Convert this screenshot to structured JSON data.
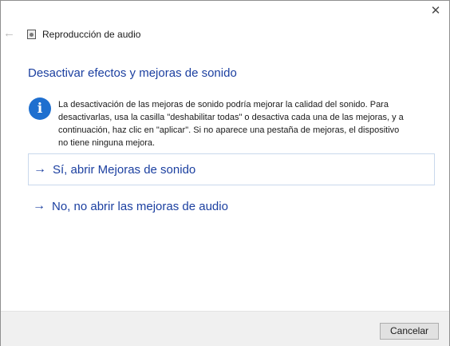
{
  "window": {
    "title": "Reproducción de audio",
    "close_glyph": "✕",
    "back_glyph": "←"
  },
  "main": {
    "heading": "Desactivar efectos y mejoras de sonido",
    "info_glyph": "i",
    "message_lines": [
      "La desactivación de las mejoras de sonido podría mejorar la calidad del sonido. Para",
      "desactivarlas, usa la casilla \"deshabilitar todas\" o desactiva cada una de las mejoras, y a",
      "continuación, haz clic en \"aplicar\". Si no aparece una pestaña de mejoras, el dispositivo",
      "no tiene ninguna mejora."
    ],
    "options": [
      {
        "arrow": "→",
        "label": "Sí, abrir Mejoras de sonido"
      },
      {
        "arrow": "→",
        "label": "No, no abrir las mejoras de audio"
      }
    ]
  },
  "footer": {
    "cancel_label": "Cancelar"
  },
  "colors": {
    "accent": "#1b3fa0",
    "info_icon": "#1e6fcf",
    "footer_bg": "#f0f0f0"
  },
  "icons": {
    "close": "close-icon",
    "back": "back-arrow-icon",
    "app": "audio-device-icon",
    "info": "info-icon",
    "option_arrow": "arrow-right-icon"
  }
}
